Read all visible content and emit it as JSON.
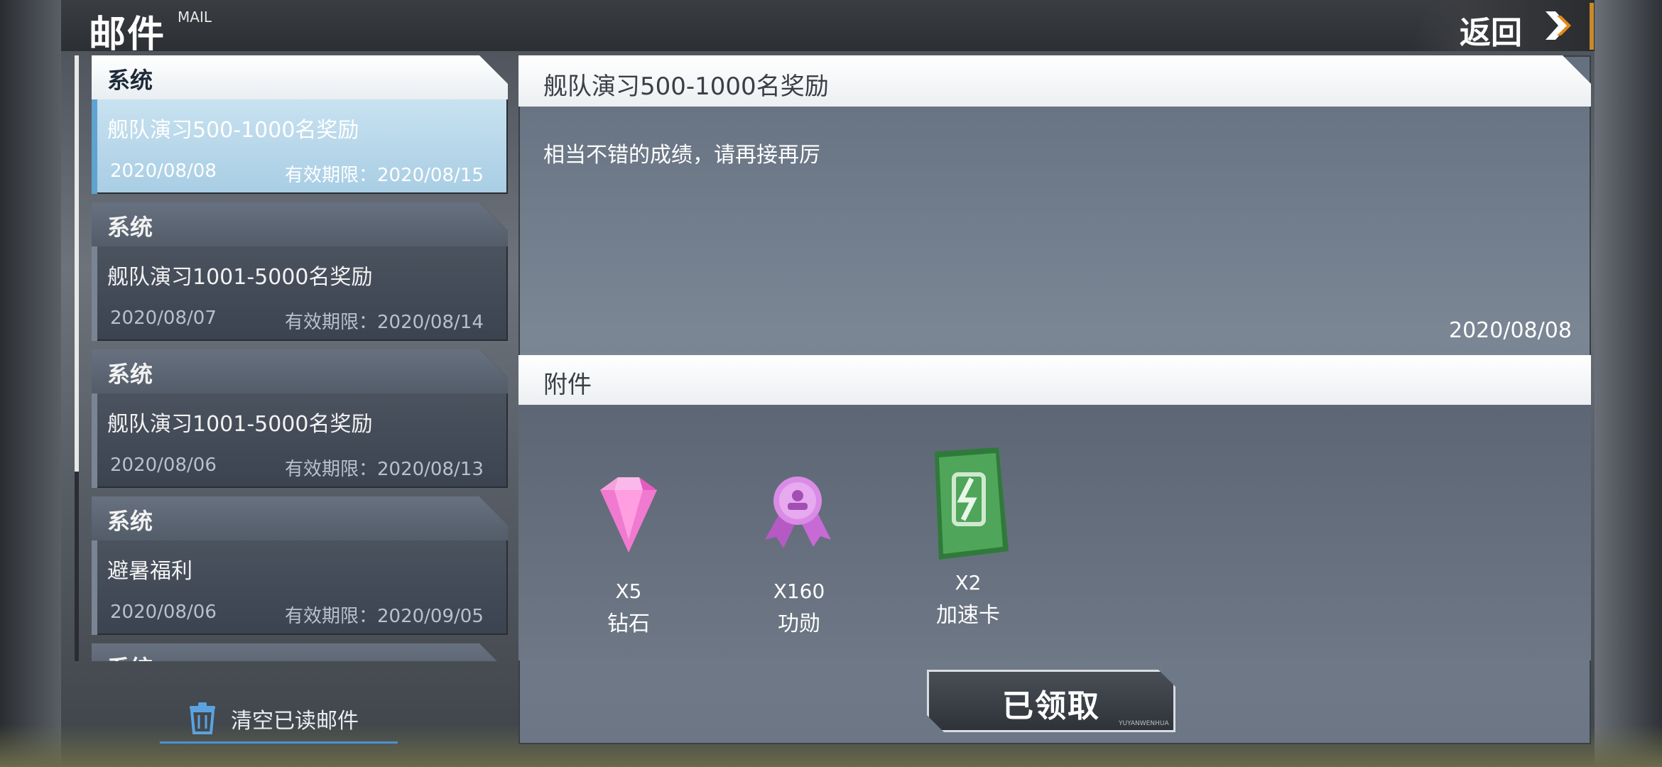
{
  "header": {
    "title": "邮件",
    "subtitle": "MAIL",
    "back_label": "返回"
  },
  "mail_list": [
    {
      "sender": "系统",
      "subject": "舰队演习500-1000名奖励",
      "date": "2020/08/08",
      "expiry": "有效期限：2020/08/15",
      "selected": true
    },
    {
      "sender": "系统",
      "subject": "舰队演习1001-5000名奖励",
      "date": "2020/08/07",
      "expiry": "有效期限：2020/08/14",
      "selected": false
    },
    {
      "sender": "系统",
      "subject": "舰队演习1001-5000名奖励",
      "date": "2020/08/06",
      "expiry": "有效期限：2020/08/13",
      "selected": false
    },
    {
      "sender": "系统",
      "subject": "避暑福利",
      "date": "2020/08/06",
      "expiry": "有效期限：2020/09/05",
      "selected": false
    },
    {
      "sender": "系统"
    }
  ],
  "clear_read_label": "清空已读邮件",
  "detail": {
    "title": "舰队演习500-1000名奖励",
    "body": "相当不错的成绩，请再接再厉",
    "date": "2020/08/08",
    "attachments_label": "附件",
    "attachments": [
      {
        "qty": "X5",
        "name": "钻石",
        "icon": "diamond-icon"
      },
      {
        "qty": "X160",
        "name": "功勋",
        "icon": "merit-medal-icon"
      },
      {
        "qty": "X2",
        "name": "加速卡",
        "icon": "speedup-card-icon"
      }
    ],
    "claim_label": "已领取",
    "claim_watermark": "YUYANWENHUA"
  },
  "colors": {
    "selected_item": "#a8cde3",
    "accent_orange": "#c98a2a",
    "tab_underline": "#4a90d9"
  }
}
